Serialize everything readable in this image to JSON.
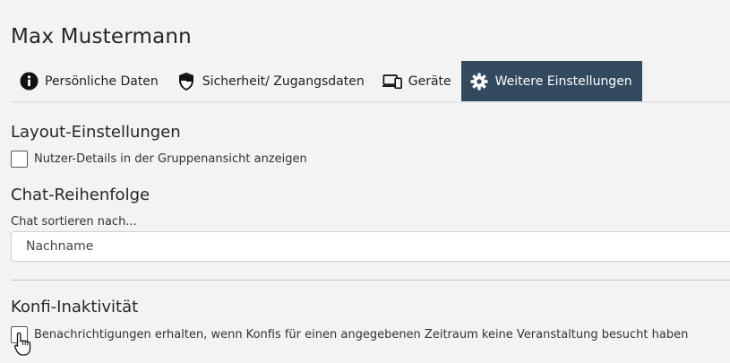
{
  "header": {
    "title": "Max Mustermann"
  },
  "tabs": [
    {
      "label": "Persönliche Daten",
      "icon": "info-icon"
    },
    {
      "label": "Sicherheit/ Zugangsdaten",
      "icon": "shield-icon"
    },
    {
      "label": "Geräte",
      "icon": "devices-icon"
    },
    {
      "label": "Weitere Einstellungen",
      "icon": "gear-icon",
      "active": true
    }
  ],
  "layout_settings": {
    "title": "Layout-Einstellungen",
    "user_details_label": "Nutzer-Details in der Gruppenansicht anzeigen",
    "user_details_checked": false
  },
  "chat_order": {
    "title": "Chat-Reihenfolge",
    "sort_label": "Chat sortieren nach...",
    "sort_value": "Nachname"
  },
  "konfi_inactivity": {
    "title": "Konfi-Inaktivität",
    "notify_label": "Benachrichtigungen erhalten, wenn Konfis für einen angegebenen Zeitraum keine Veranstaltung besucht haben",
    "notify_checked": false
  },
  "colors": {
    "active_tab_bg": "#33495e",
    "background": "#f3f3f3"
  }
}
